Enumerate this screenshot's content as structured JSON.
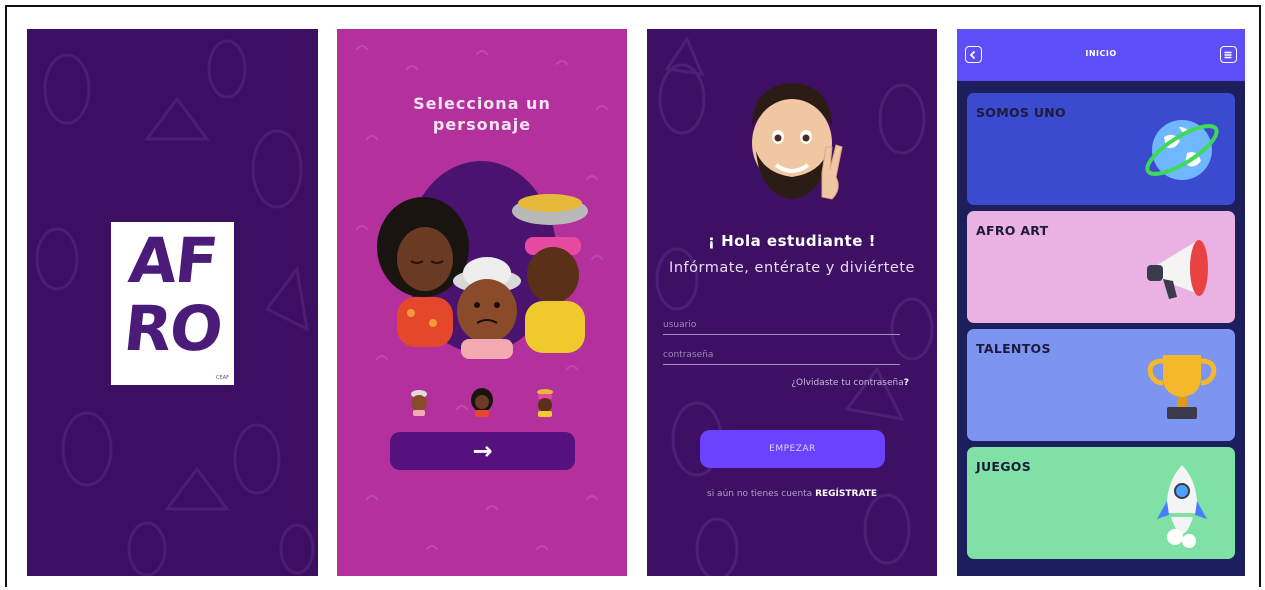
{
  "screens": {
    "splash": {
      "logo_line1": "AF",
      "logo_line2": "RO",
      "logo_small": "CEAF"
    },
    "character_select": {
      "title_line1": "Selecciona un",
      "title_line2": "personaje",
      "next_button_symbol": "→"
    },
    "login": {
      "greeting": "¡ Hola estudiante !",
      "subtitle": "Infórmate, entérate y diviértete",
      "username_placeholder": "usuario",
      "password_placeholder": "contraseña",
      "forgot_text": "¿Olvidaste tu contraseña",
      "forgot_question_mark": "?",
      "start_button": "EMPEZAR",
      "register_prompt": "si aún no tienes cuenta",
      "register_link": "REGÍSTRATE"
    },
    "home": {
      "title": "INICIO",
      "cards": [
        {
          "label": "SOMOS UNO",
          "color": "#3b4bcf",
          "icon": "globe-icon"
        },
        {
          "label": "AFRO ART",
          "color": "#eab2e2",
          "icon": "megaphone-icon"
        },
        {
          "label": "TALENTOS",
          "color": "#7c95f0",
          "icon": "trophy-icon"
        },
        {
          "label": "JUEGOS",
          "color": "#7fe1a6",
          "icon": "rocket-icon"
        }
      ]
    }
  },
  "colors": {
    "splash_bg": "#3d0f63",
    "select_bg": "#b4309c",
    "login_bg": "#3e1064",
    "home_bg": "#1d1f5c",
    "accent": "#6a42ff"
  }
}
